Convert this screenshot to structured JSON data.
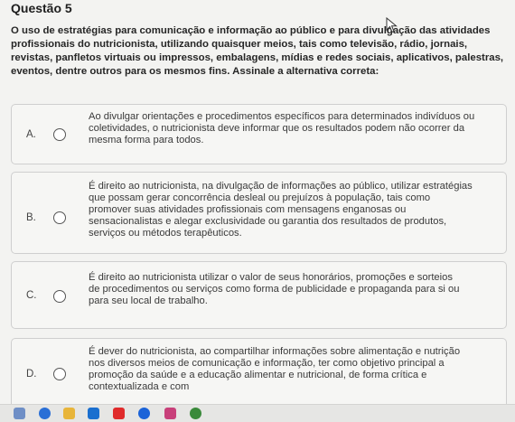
{
  "question": {
    "title": "Questão 5",
    "stem": "O uso de estratégias para comunicação e informação ao público e para divulgação das atividades profissionais do nutricionista, utilizando quaisquer meios, tais como televisão, rádio, jornais, revistas, panfletos virtuais ou impressos, embalagens, mídias e redes sociais, aplicativos, palestras, eventos, dentre outros para os mesmos fins. Assinale a alternativa correta:"
  },
  "options": [
    {
      "letter": "A.",
      "text": "Ao divulgar orientações e procedimentos específicos para determinados indivíduos ou coletividades, o nutricionista deve informar que os resultados podem não ocorrer da mesma forma para todos."
    },
    {
      "letter": "B.",
      "text": "É direito ao nutricionista, na divulgação de informações ao público, utilizar estratégias que possam gerar concorrência desleal ou prejuízos à população, tais como promover suas atividades profissionais com mensagens enganosas ou sensacionalistas e alegar exclusividade ou garantia dos resultados de produtos, serviços ou métodos terapêuticos."
    },
    {
      "letter": "C.",
      "text": "É direito ao nutricionista utilizar o valor de seus honorários, promoções e sorteios de procedimentos ou serviços como forma de publicidade e propaganda para si ou para seu local de trabalho."
    },
    {
      "letter": "D.",
      "text": "É dever do nutricionista, ao compartilhar informações sobre alimentação e nutrição nos diversos meios de comunicação e informação, ter como objetivo principal a promoção da saúde e a educação alimentar e nutricional, de forma crítica e contextualizada e com"
    }
  ],
  "taskbar": {
    "icons": [
      "paint-icon",
      "browser-icon",
      "folder-icon",
      "outlook-icon",
      "youtube-icon",
      "facebook-icon",
      "instagram-icon",
      "chrome-icon"
    ],
    "colors": [
      "#6f8fc6",
      "#2a6fd6",
      "#e8b53a",
      "#1a6fcf",
      "#e02b2b",
      "#1b63d8",
      "#c8407a",
      "#3a8a3a"
    ]
  }
}
